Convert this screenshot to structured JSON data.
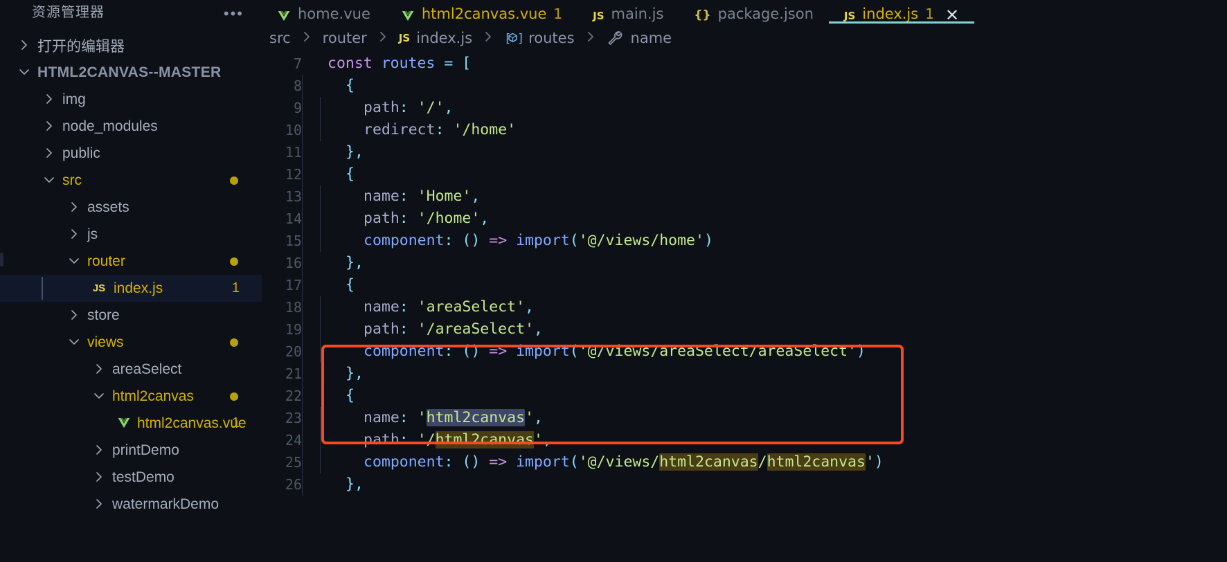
{
  "sidebar": {
    "title": "资源管理器",
    "more_icon": "ellipsis-icon",
    "items": [
      {
        "label": "打开的编辑器",
        "indent": 0,
        "type": "section",
        "state": "collapsed",
        "icon": "chevron-right-icon",
        "badge": "",
        "dot": false,
        "modified": false
      },
      {
        "label": "HTML2CANVAS--MASTER",
        "indent": 0,
        "type": "root",
        "state": "expanded",
        "icon": "chevron-down-icon",
        "badge": "",
        "dot": false,
        "modified": false
      },
      {
        "label": "img",
        "indent": 1,
        "type": "folder",
        "state": "collapsed",
        "icon": "chevron-right-icon",
        "badge": "",
        "dot": false,
        "modified": false
      },
      {
        "label": "node_modules",
        "indent": 1,
        "type": "folder",
        "state": "collapsed",
        "icon": "chevron-right-icon",
        "badge": "",
        "dot": false,
        "modified": false
      },
      {
        "label": "public",
        "indent": 1,
        "type": "folder",
        "state": "collapsed",
        "icon": "chevron-right-icon",
        "badge": "",
        "dot": false,
        "modified": false
      },
      {
        "label": "src",
        "indent": 1,
        "type": "folder",
        "state": "expanded",
        "icon": "chevron-down-icon",
        "badge": "",
        "dot": true,
        "modified": true
      },
      {
        "label": "assets",
        "indent": 2,
        "type": "folder",
        "state": "collapsed",
        "icon": "chevron-right-icon",
        "badge": "",
        "dot": false,
        "modified": false
      },
      {
        "label": "js",
        "indent": 2,
        "type": "folder",
        "state": "collapsed",
        "icon": "chevron-right-icon",
        "badge": "",
        "dot": false,
        "modified": false
      },
      {
        "label": "router",
        "indent": 2,
        "type": "folder",
        "state": "expanded",
        "icon": "chevron-down-icon",
        "badge": "",
        "dot": true,
        "modified": true
      },
      {
        "label": "index.js",
        "indent": 3,
        "type": "file-js",
        "state": "",
        "icon": "js-file-icon",
        "badge": "1",
        "dot": false,
        "modified": true,
        "selected": true
      },
      {
        "label": "store",
        "indent": 2,
        "type": "folder",
        "state": "collapsed",
        "icon": "chevron-right-icon",
        "badge": "",
        "dot": false,
        "modified": false
      },
      {
        "label": "views",
        "indent": 2,
        "type": "folder",
        "state": "expanded",
        "icon": "chevron-down-icon",
        "badge": "",
        "dot": true,
        "modified": true
      },
      {
        "label": "areaSelect",
        "indent": 3,
        "type": "folder",
        "state": "collapsed",
        "icon": "chevron-right-icon",
        "badge": "",
        "dot": false,
        "modified": false
      },
      {
        "label": "html2canvas",
        "indent": 3,
        "type": "folder",
        "state": "expanded",
        "icon": "chevron-down-icon",
        "badge": "",
        "dot": true,
        "modified": true
      },
      {
        "label": "html2canvas.vue",
        "indent": 4,
        "type": "file-vue",
        "state": "",
        "icon": "vue-file-icon",
        "badge": "1",
        "dot": false,
        "modified": true
      },
      {
        "label": "printDemo",
        "indent": 3,
        "type": "folder",
        "state": "collapsed",
        "icon": "chevron-right-icon",
        "badge": "",
        "dot": false,
        "modified": false
      },
      {
        "label": "testDemo",
        "indent": 3,
        "type": "folder",
        "state": "collapsed",
        "icon": "chevron-right-icon",
        "badge": "",
        "dot": false,
        "modified": false
      },
      {
        "label": "watermarkDemo",
        "indent": 3,
        "type": "folder",
        "state": "collapsed",
        "icon": "chevron-right-icon",
        "badge": "",
        "dot": false,
        "modified": false
      }
    ]
  },
  "tabs": [
    {
      "label": "home.vue",
      "icon": "vue-file-icon",
      "count": "",
      "active": false,
      "modified": false,
      "closable": false
    },
    {
      "label": "html2canvas.vue",
      "icon": "vue-file-icon",
      "count": "1",
      "active": false,
      "modified": true,
      "closable": false
    },
    {
      "label": "main.js",
      "icon": "js-file-icon",
      "count": "",
      "active": false,
      "modified": false,
      "closable": false
    },
    {
      "label": "package.json",
      "icon": "json-file-icon",
      "count": "",
      "active": false,
      "modified": false,
      "closable": false
    },
    {
      "label": "index.js",
      "icon": "js-file-icon",
      "count": "1",
      "active": true,
      "modified": true,
      "closable": true,
      "close_icon": "close-icon"
    }
  ],
  "breadcrumb": [
    {
      "label": "src",
      "icon": ""
    },
    {
      "label": "router",
      "icon": ""
    },
    {
      "label": "index.js",
      "icon": "js-file-icon"
    },
    {
      "label": "routes",
      "icon": "array-symbol-icon"
    },
    {
      "label": "name",
      "icon": "property-symbol-icon"
    }
  ],
  "editor": {
    "first_visible_line": 7,
    "lines": [
      {
        "n": "7",
        "indent": 0,
        "tokens": [
          {
            "t": "const",
            "c": "t-kw"
          },
          {
            "t": " ",
            "c": "t-white"
          },
          {
            "t": "routes",
            "c": "t-var"
          },
          {
            "t": " ",
            "c": "t-white"
          },
          {
            "t": "=",
            "c": "t-op"
          },
          {
            "t": " ",
            "c": "t-white"
          },
          {
            "t": "[",
            "c": "t-punc"
          }
        ]
      },
      {
        "n": "8",
        "indent": 1,
        "tokens": [
          {
            "t": "{",
            "c": "t-punc"
          }
        ]
      },
      {
        "n": "9",
        "indent": 2,
        "tokens": [
          {
            "t": "path",
            "c": "t-prop"
          },
          {
            "t": ":",
            "c": "t-op"
          },
          {
            "t": " ",
            "c": "t-white"
          },
          {
            "t": "'/'",
            "c": "t-str"
          },
          {
            "t": ",",
            "c": "t-op"
          }
        ]
      },
      {
        "n": "10",
        "indent": 2,
        "tokens": [
          {
            "t": "redirect",
            "c": "t-prop"
          },
          {
            "t": ":",
            "c": "t-op"
          },
          {
            "t": " ",
            "c": "t-white"
          },
          {
            "t": "'/home'",
            "c": "t-str"
          }
        ]
      },
      {
        "n": "11",
        "indent": 1,
        "tokens": [
          {
            "t": "}",
            "c": "t-punc"
          },
          {
            "t": ",",
            "c": "t-op"
          }
        ]
      },
      {
        "n": "12",
        "indent": 1,
        "tokens": [
          {
            "t": "{",
            "c": "t-punc"
          }
        ]
      },
      {
        "n": "13",
        "indent": 2,
        "tokens": [
          {
            "t": "name",
            "c": "t-prop"
          },
          {
            "t": ":",
            "c": "t-op"
          },
          {
            "t": " ",
            "c": "t-white"
          },
          {
            "t": "'Home'",
            "c": "t-str"
          },
          {
            "t": ",",
            "c": "t-op"
          }
        ]
      },
      {
        "n": "14",
        "indent": 2,
        "tokens": [
          {
            "t": "path",
            "c": "t-prop"
          },
          {
            "t": ":",
            "c": "t-op"
          },
          {
            "t": " ",
            "c": "t-white"
          },
          {
            "t": "'/home'",
            "c": "t-str"
          },
          {
            "t": ",",
            "c": "t-op"
          }
        ]
      },
      {
        "n": "15",
        "indent": 2,
        "tokens": [
          {
            "t": "component",
            "c": "t-fn"
          },
          {
            "t": ":",
            "c": "t-op"
          },
          {
            "t": " ",
            "c": "t-white"
          },
          {
            "t": "()",
            "c": "t-op"
          },
          {
            "t": " ",
            "c": "t-white"
          },
          {
            "t": "=>",
            "c": "t-arrow"
          },
          {
            "t": " ",
            "c": "t-white"
          },
          {
            "t": "import",
            "c": "t-fn"
          },
          {
            "t": "(",
            "c": "t-op"
          },
          {
            "t": "'@/views/home'",
            "c": "t-str"
          },
          {
            "t": ")",
            "c": "t-op"
          }
        ]
      },
      {
        "n": "16",
        "indent": 1,
        "tokens": [
          {
            "t": "}",
            "c": "t-punc"
          },
          {
            "t": ",",
            "c": "t-op"
          }
        ]
      },
      {
        "n": "17",
        "indent": 1,
        "tokens": [
          {
            "t": "{",
            "c": "t-punc"
          }
        ]
      },
      {
        "n": "18",
        "indent": 2,
        "tokens": [
          {
            "t": "name",
            "c": "t-prop"
          },
          {
            "t": ":",
            "c": "t-op"
          },
          {
            "t": " ",
            "c": "t-white"
          },
          {
            "t": "'areaSelect'",
            "c": "t-str"
          },
          {
            "t": ",",
            "c": "t-op"
          }
        ]
      },
      {
        "n": "19",
        "indent": 2,
        "tokens": [
          {
            "t": "path",
            "c": "t-prop"
          },
          {
            "t": ":",
            "c": "t-op"
          },
          {
            "t": " ",
            "c": "t-white"
          },
          {
            "t": "'/areaSelect'",
            "c": "t-str"
          },
          {
            "t": ",",
            "c": "t-op"
          }
        ]
      },
      {
        "n": "20",
        "indent": 2,
        "tokens": [
          {
            "t": "component",
            "c": "t-fn"
          },
          {
            "t": ":",
            "c": "t-op"
          },
          {
            "t": " ",
            "c": "t-white"
          },
          {
            "t": "()",
            "c": "t-op"
          },
          {
            "t": " ",
            "c": "t-white"
          },
          {
            "t": "=>",
            "c": "t-arrow"
          },
          {
            "t": " ",
            "c": "t-white"
          },
          {
            "t": "import",
            "c": "t-fn"
          },
          {
            "t": "(",
            "c": "t-op"
          },
          {
            "t": "'@/views/areaSelect/areaSelect'",
            "c": "t-str"
          },
          {
            "t": ")",
            "c": "t-op"
          }
        ]
      },
      {
        "n": "21",
        "indent": 1,
        "tokens": [
          {
            "t": "}",
            "c": "t-punc"
          },
          {
            "t": ",",
            "c": "t-op"
          }
        ]
      },
      {
        "n": "22",
        "indent": 1,
        "tokens": [
          {
            "t": "{",
            "c": "t-punc"
          }
        ]
      },
      {
        "n": "23",
        "indent": 2,
        "tokens": [
          {
            "t": "name",
            "c": "t-prop"
          },
          {
            "t": ":",
            "c": "t-op"
          },
          {
            "t": " ",
            "c": "t-white"
          },
          {
            "t": "'",
            "c": "t-str"
          },
          {
            "t": "html2canvas",
            "c": "t-str",
            "hl": "sel"
          },
          {
            "t": "'",
            "c": "t-str"
          },
          {
            "t": ",",
            "c": "t-op"
          }
        ]
      },
      {
        "n": "24",
        "indent": 2,
        "tokens": [
          {
            "t": "path",
            "c": "t-prop"
          },
          {
            "t": ":",
            "c": "t-op"
          },
          {
            "t": " ",
            "c": "t-white"
          },
          {
            "t": "'/",
            "c": "t-str"
          },
          {
            "t": "html2canvas",
            "c": "t-str",
            "hl": "word"
          },
          {
            "t": "'",
            "c": "t-str"
          },
          {
            "t": ",",
            "c": "t-op"
          }
        ]
      },
      {
        "n": "25",
        "indent": 2,
        "tokens": [
          {
            "t": "component",
            "c": "t-fn"
          },
          {
            "t": ":",
            "c": "t-op"
          },
          {
            "t": " ",
            "c": "t-white"
          },
          {
            "t": "()",
            "c": "t-op"
          },
          {
            "t": " ",
            "c": "t-white"
          },
          {
            "t": "=>",
            "c": "t-arrow"
          },
          {
            "t": " ",
            "c": "t-white"
          },
          {
            "t": "import",
            "c": "t-fn"
          },
          {
            "t": "(",
            "c": "t-op"
          },
          {
            "t": "'@/views/",
            "c": "t-str"
          },
          {
            "t": "html2canvas",
            "c": "t-str",
            "hl": "word"
          },
          {
            "t": "/",
            "c": "t-str"
          },
          {
            "t": "html2canvas",
            "c": "t-str",
            "hl": "word"
          },
          {
            "t": "'",
            "c": "t-str"
          },
          {
            "t": ")",
            "c": "t-op"
          }
        ]
      },
      {
        "n": "26",
        "indent": 1,
        "tokens": [
          {
            "t": "}",
            "c": "t-punc"
          },
          {
            "t": ",",
            "c": "t-op"
          }
        ]
      }
    ]
  },
  "annotation": {
    "shape": "rectangle",
    "color": "#f64a22",
    "covers_lines": [
      "22",
      "23",
      "24",
      "25",
      "26"
    ]
  },
  "colors": {
    "background": "#0d1117",
    "modified_file": "#d3b102",
    "active_tab_underline": "#7fd6cf",
    "annotation": "#f64a22",
    "selection_highlight": "#3f4668",
    "word_match_highlight": "#4a3d14"
  }
}
